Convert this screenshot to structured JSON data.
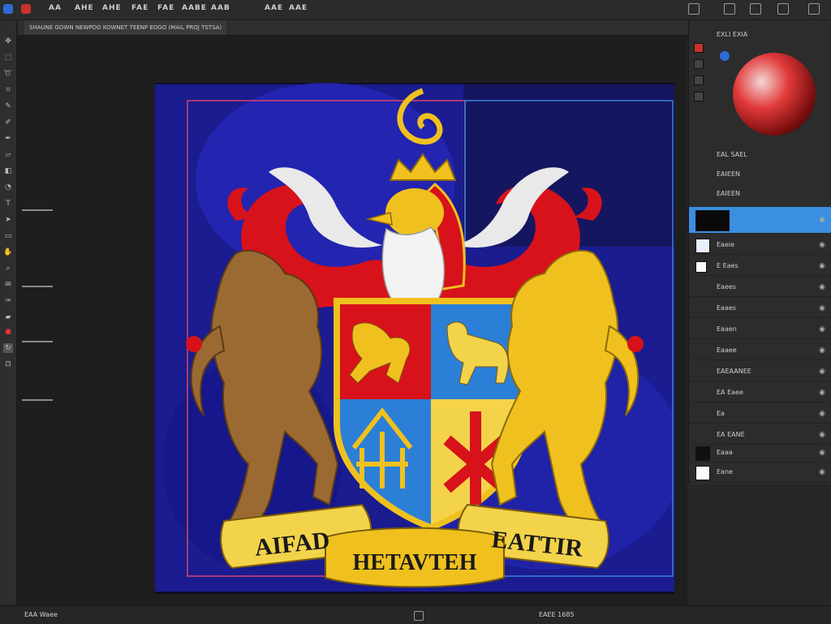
{
  "menubar": {
    "items": [
      "AA",
      "AHE",
      "AHE",
      "FAE",
      "FAE",
      "AABE",
      "AAB",
      "AAE",
      "AAE"
    ],
    "right_buttons": [
      "panels",
      "layout",
      "minimize",
      "maximize",
      "close"
    ]
  },
  "document": {
    "tab_label": "SHAUNE GOWN NEWPDO KOWNET TEENP EOGO (MAIL PROJ TSTSA)"
  },
  "tools": [
    "move",
    "marquee",
    "lasso",
    "crop",
    "eyedropper",
    "brush",
    "pen",
    "eraser",
    "gradient",
    "dodge",
    "text",
    "path",
    "shape",
    "hand",
    "zoom",
    "note",
    "pen2",
    "paint",
    "rotate",
    "lock",
    "swap",
    "fgbg"
  ],
  "crest": {
    "motto_left": "AIFAD",
    "motto_center": "HETAVTEH",
    "motto_right": "EATTIR"
  },
  "colors": {
    "background_blue": "#1f23a8",
    "crest_red": "#d7121a",
    "crest_gold": "#f0c11e",
    "crest_blue": "#2c7fd6",
    "lion_brown": "#9b6a33",
    "accent_blue_layer": "#3a8fe0",
    "guide_pink": "#d8426e",
    "guide_blue": "#3c7de0"
  },
  "panel": {
    "color_header": "EXLI EXIA",
    "swatch_label": "EAL SAEL",
    "layers_header": "EAIEEN",
    "layers_subheader": "EAIEEN",
    "layers": [
      {
        "name": "",
        "selected": true,
        "thumb": "dark"
      },
      {
        "name": "Eaeie",
        "selected": false,
        "thumb": "blue"
      },
      {
        "name": "E Eaes",
        "selected": false,
        "thumb": "white"
      },
      {
        "name": "Eaees",
        "selected": false,
        "thumb": "none"
      },
      {
        "name": "Eaaes",
        "selected": false,
        "thumb": "none"
      },
      {
        "name": "Eaaen",
        "selected": false,
        "thumb": "none"
      },
      {
        "name": "Eaaee",
        "selected": false,
        "thumb": "none"
      },
      {
        "name": "EAEAANEE",
        "selected": false,
        "thumb": "none"
      },
      {
        "name": "EA Eaee",
        "selected": false,
        "thumb": "none"
      },
      {
        "name": "Ea",
        "selected": false,
        "thumb": "none"
      },
      {
        "name": "EA EANE",
        "selected": false,
        "thumb": "none"
      },
      {
        "name": "Eaaa",
        "selected": false,
        "thumb": "none"
      },
      {
        "name": "Eane",
        "selected": false,
        "thumb": "none"
      }
    ]
  },
  "status": {
    "left": "EAA Waee",
    "center_icon": "status-icon",
    "right": "EAEE 1685"
  }
}
